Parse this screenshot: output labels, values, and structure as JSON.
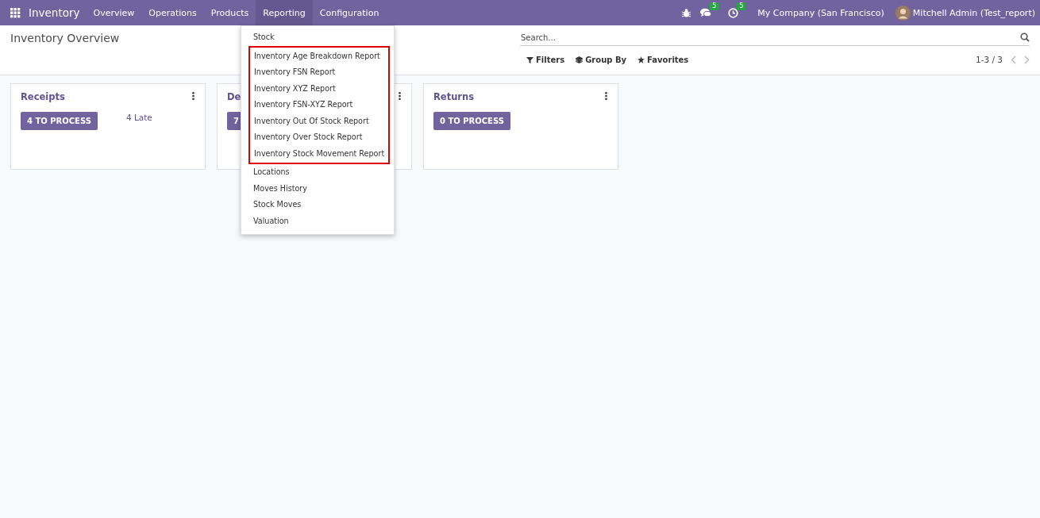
{
  "navbar": {
    "app_name": "Inventory",
    "menus": [
      {
        "label": "Overview",
        "selected": false
      },
      {
        "label": "Operations",
        "selected": false
      },
      {
        "label": "Products",
        "selected": false
      },
      {
        "label": "Reporting",
        "selected": true
      },
      {
        "label": "Configuration",
        "selected": false
      }
    ],
    "messages_count": "5",
    "activities_count": "5",
    "company": "My Company (San Francisco)",
    "user": "Mitchell Admin (Test_report)"
  },
  "control_panel": {
    "title": "Inventory Overview",
    "search": {
      "placeholder": "Search..."
    },
    "filters": [
      "Filters",
      "Group By",
      "Favorites"
    ],
    "pager": "1-3 / 3"
  },
  "cards": [
    {
      "title": "Receipts",
      "button": "4 TO PROCESS",
      "late": "4 Late"
    },
    {
      "title": "De",
      "button": "7"
    },
    {
      "title": "Returns",
      "button": "0 TO PROCESS"
    }
  ],
  "dropdown": {
    "sections": [
      {
        "kind": "plain",
        "items": [
          "Stock"
        ]
      },
      {
        "kind": "highlighted",
        "items": [
          "Inventory Age Breakdown Report",
          "Inventory FSN Report",
          "Inventory XYZ Report",
          "Inventory FSN-XYZ Report",
          "Inventory Out Of Stock Report",
          "Inventory Over Stock Report",
          "Inventory Stock Movement Report"
        ]
      },
      {
        "kind": "plain",
        "items": [
          "Locations",
          "Moves History",
          "Stock Moves",
          "Valuation"
        ]
      }
    ]
  }
}
